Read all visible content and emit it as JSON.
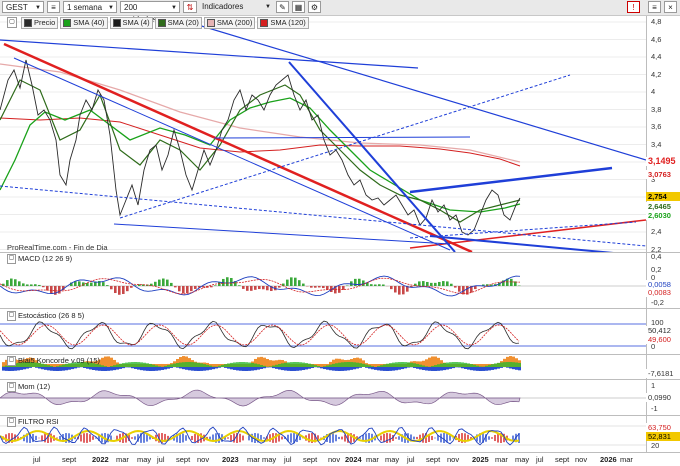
{
  "toolbar": {
    "symbol": "GEST",
    "period": "1 semana",
    "units": "200 unidades",
    "indicators_label": "Indicadores"
  },
  "legend": [
    {
      "label": "Precio",
      "color": "#2a2a2a"
    },
    {
      "label": "SMA (40)",
      "color": "#1aa21a"
    },
    {
      "label": "SMA (4)",
      "color": "#1a1a1a"
    },
    {
      "label": "SMA (20)",
      "color": "#2e6b1a"
    },
    {
      "label": "SMA (200)",
      "color": "#e6b4b4"
    },
    {
      "label": "SMA (120)",
      "color": "#d42020"
    }
  ],
  "price_axis": [
    "4,8",
    "4,6",
    "4,4",
    "4,2",
    "4",
    "3,8",
    "3,6",
    "3,4",
    "3,2",
    "3",
    "2,8",
    "2,6",
    "2,4",
    "2,2"
  ],
  "price_tags": {
    "tag1": "3,1495",
    "tag2": "3,0763",
    "tag3": "2,754",
    "tag4": "2,6465",
    "tag5": "2,6030"
  },
  "watermark": "ProRealTime.com - Fin de Dia",
  "panels": {
    "macd": {
      "label": "MACD (12 26 9)",
      "axis": [
        "0,4",
        "0,2",
        "0",
        "-0,2"
      ],
      "tags": [
        "0,0058",
        "0,0083"
      ]
    },
    "stoch": {
      "label": "Estocástico (26 8 5)",
      "axis": [
        "100",
        "0"
      ],
      "tags": [
        "50,412",
        "49,600"
      ]
    },
    "blai5": {
      "label": "Blai5 Koncorde v.09 (15)",
      "tags": [
        "-7,6181"
      ]
    },
    "mom": {
      "label": "Mom (12)",
      "axis": [
        "1",
        "-1"
      ],
      "tags": [
        "0,0990"
      ]
    },
    "rsi": {
      "label": "FILTRO RSI",
      "axis": [
        "80",
        "20"
      ],
      "tags": [
        "63,750",
        "52,831"
      ]
    }
  },
  "time_axis": [
    "jul",
    "sept",
    "2022",
    "mar",
    "may",
    "jul",
    "sept",
    "nov",
    "2023",
    "mar",
    "may",
    "jul",
    "sept",
    "nov",
    "2024",
    "mar",
    "may",
    "jul",
    "sept",
    "nov",
    "2025",
    "mar",
    "may",
    "jul",
    "sept",
    "nov",
    "2026",
    "mar"
  ]
}
